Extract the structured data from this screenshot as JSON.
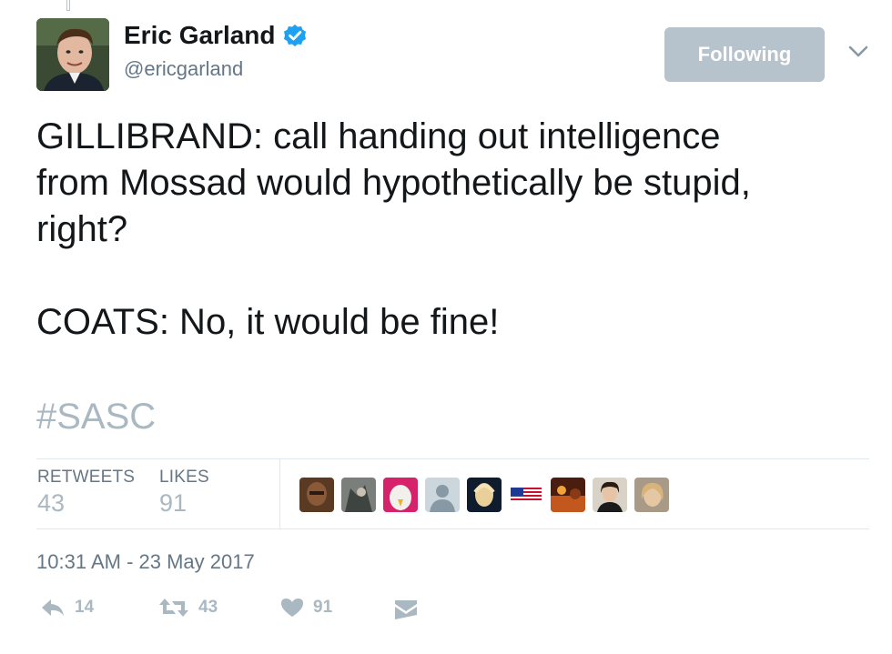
{
  "user": {
    "display_name": "Eric Garland",
    "handle": "@ericgarland",
    "verified": true
  },
  "follow_button": {
    "label": "Following"
  },
  "tweet": {
    "text": "GILLIBRAND: call handing out intelligence\nfrom Mossad would hypothetically be stupid,\nright?\n\nCOATS: No, it would be fine!",
    "hashtag": "#SASC"
  },
  "stats": {
    "retweets_label": "RETWEETS",
    "retweets_count": "43",
    "likes_label": "LIKES",
    "likes_count": "91"
  },
  "timestamp": "10:31 AM - 23 May 2017",
  "actions": {
    "reply_count": "14",
    "retweet_count": "43",
    "like_count": "91"
  },
  "colors": {
    "accent": "#1da1f2",
    "muted": "#aab8c2",
    "follow_button_bg": "#b6c2cc",
    "text": "#14171a"
  }
}
